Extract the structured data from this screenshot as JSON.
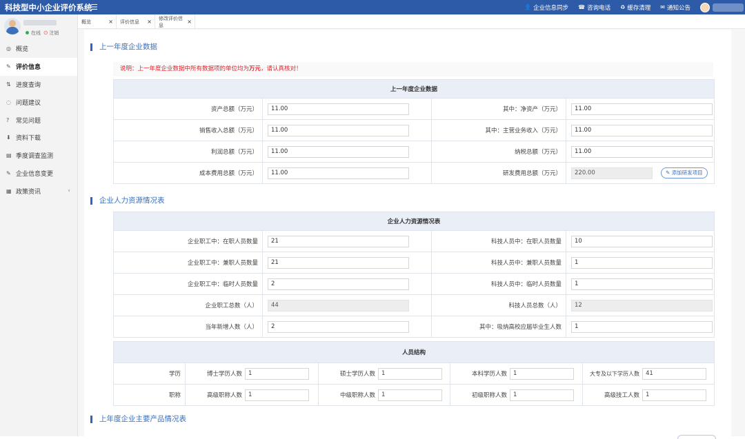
{
  "app": {
    "title": "科技型中小企业评价系统"
  },
  "topbar": {
    "links": [
      {
        "icon": "person-icon",
        "label": "企业信息同步"
      },
      {
        "icon": "phone-icon",
        "label": "咨询电话"
      },
      {
        "icon": "recycle-icon",
        "label": "缓存清理"
      },
      {
        "icon": "mail-icon",
        "label": "通知公告"
      }
    ]
  },
  "sidebar": {
    "status_online": "在线",
    "status_logout": "注销",
    "items": [
      {
        "icon": "overview-icon",
        "label": "概览"
      },
      {
        "icon": "edit-icon",
        "label": "评价信息",
        "active": true
      },
      {
        "icon": "progress-icon",
        "label": "进度查询"
      },
      {
        "icon": "chat-icon",
        "label": "问题建议"
      },
      {
        "icon": "question-icon",
        "label": "常见问题"
      },
      {
        "icon": "download-icon",
        "label": "资料下载"
      },
      {
        "icon": "survey-icon",
        "label": "季度调查监测"
      },
      {
        "icon": "edit-icon",
        "label": "企业信息变更"
      },
      {
        "icon": "news-icon",
        "label": "政策资讯"
      }
    ]
  },
  "tabs": [
    {
      "label": "概览"
    },
    {
      "label": "评价信息"
    },
    {
      "label": "修改评价信息"
    }
  ],
  "sections": {
    "finance_title": "上一年度企业数据",
    "hr_title": "企业人力资源情况表",
    "products_title": "上年度企业主要产品情况表"
  },
  "notice": {
    "prefix": "说明：上一年度企业数据中所有数据项的单位均为",
    "unit": "万元",
    "suffix": "，请认真核对！"
  },
  "finance": {
    "header": "上一年度企业数据",
    "rows": [
      [
        {
          "label": "资产总额（万元）",
          "value": "11.00"
        },
        {
          "label": "其中：净资产（万元）",
          "value": "11.00"
        }
      ],
      [
        {
          "label": "销售收入总额（万元）",
          "value": "11.00"
        },
        {
          "label": "其中：主营业务收入（万元）",
          "value": "11.00"
        }
      ],
      [
        {
          "label": "利润总额（万元）",
          "value": "11.00"
        },
        {
          "label": "纳税总额（万元）",
          "value": "11.00"
        }
      ],
      [
        {
          "label": "成本费用总额（万元）",
          "value": "11.00"
        },
        {
          "label": "研发费用总额（万元）",
          "value": "220.00"
        }
      ]
    ],
    "add_rd_button": "添加研发项目"
  },
  "hr": {
    "header": "企业人力资源情况表",
    "rows": [
      [
        {
          "label": "企业职工中：在职人员数量",
          "value": "21"
        },
        {
          "label": "科技人员中：在职人员数量",
          "value": "10"
        }
      ],
      [
        {
          "label": "企业职工中：兼职人员数量",
          "value": "21"
        },
        {
          "label": "科技人员中：兼职人员数量",
          "value": "1"
        }
      ],
      [
        {
          "label": "企业职工中：临时人员数量",
          "value": "2"
        },
        {
          "label": "科技人员中：临时人员数量",
          "value": "1"
        }
      ],
      [
        {
          "label": "企业职工总数（人）",
          "value": "44"
        },
        {
          "label": "科技人员总数（人）",
          "value": "12"
        }
      ],
      [
        {
          "label": "当年新增人数（人）",
          "value": "2"
        },
        {
          "label": "其中：吸纳高校应届毕业生人数",
          "value": "1"
        }
      ]
    ]
  },
  "structure": {
    "header": "人员结构",
    "education_label": "学历",
    "education": [
      {
        "label": "博士学历人数",
        "value": "1"
      },
      {
        "label": "硕士学历人数",
        "value": "1"
      },
      {
        "label": "本科学历人数",
        "value": "1"
      },
      {
        "label": "大专及以下学历人数",
        "value": "41"
      }
    ],
    "title_label": "职称",
    "titles": [
      {
        "label": "高级职称人数",
        "value": "1"
      },
      {
        "label": "中级职称人数",
        "value": "1"
      },
      {
        "label": "初级职称人数",
        "value": "1"
      },
      {
        "label": "高级技工人数",
        "value": "1"
      }
    ]
  }
}
